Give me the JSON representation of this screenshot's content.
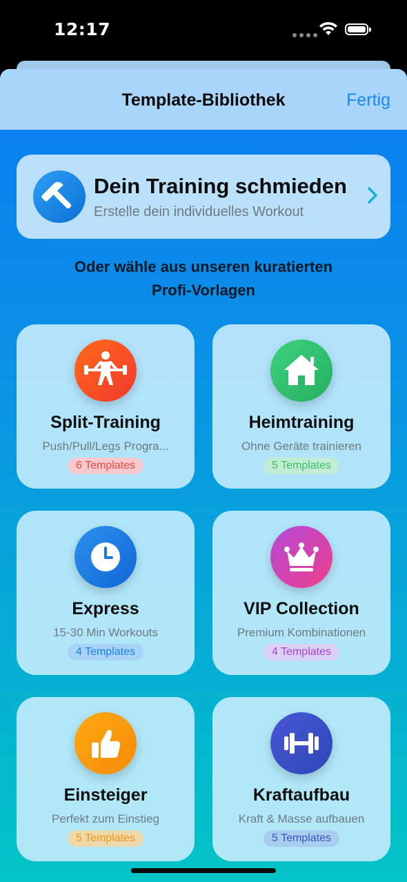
{
  "status": {
    "time": "12:17"
  },
  "nav": {
    "title": "Template-Bibliothek",
    "done": "Fertig"
  },
  "builder": {
    "title": "Dein Training schmieden",
    "subtitle": "Erstelle dein individuelles Workout",
    "icon": "hammer-icon"
  },
  "section": {
    "line1": "Oder wähle aus unseren kuratierten",
    "line2": "Profi-Vorlagen"
  },
  "cards": [
    {
      "title": "Split-Training",
      "subtitle": "Push/Pull/Legs Progra...",
      "badge": "6 Templates",
      "icon": "weightlifter-icon",
      "color": "#f2453a",
      "badge_bg": "#f6c9cf"
    },
    {
      "title": "Heimtraining",
      "subtitle": "Ohne Geräte trainieren",
      "badge": "5 Templates",
      "icon": "house-icon",
      "color": "#35c46a",
      "badge_bg": "#c3ecd6"
    },
    {
      "title": "Express",
      "subtitle": "15-30 Min Workouts",
      "badge": "4 Templates",
      "icon": "clock-icon",
      "color": "#1d7fe6",
      "badge_bg": "#a6d3f6"
    },
    {
      "title": "VIP Collection",
      "subtitle": "Premium Kombinationen",
      "badge": "4 Templates",
      "icon": "crown-icon",
      "color": "#a445d8",
      "badge_bg": "#dbd1f4"
    },
    {
      "title": "Einsteiger",
      "subtitle": "Perfekt zum Einstieg",
      "badge": "5 Templates",
      "icon": "thumbs-up-icon",
      "color": "#f5970e",
      "badge_bg": "#eed9ac"
    },
    {
      "title": "Kraftaufbau",
      "subtitle": "Kraft & Masse aufbauen",
      "badge": "5 Templates",
      "icon": "dumbbell-icon",
      "color": "#3656c4",
      "badge_bg": "#a9cdee"
    }
  ]
}
